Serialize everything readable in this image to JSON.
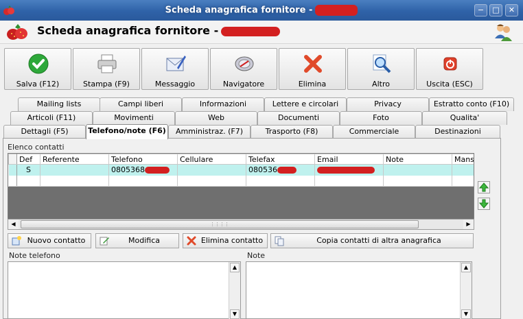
{
  "window": {
    "title": "Scheda anagrafica fornitore -",
    "controls": [
      "−",
      "□",
      "✕"
    ]
  },
  "header": {
    "title": "Scheda anagrafica fornitore -"
  },
  "toolbar": {
    "buttons": [
      {
        "label": "Salva (F12)",
        "icon": "check-icon"
      },
      {
        "label": "Stampa (F9)",
        "icon": "printer-icon"
      },
      {
        "label": "Messaggio",
        "icon": "message-icon"
      },
      {
        "label": "Navigatore",
        "icon": "compass-icon"
      },
      {
        "label": "Elimina",
        "icon": "delete-icon"
      },
      {
        "label": "Altro",
        "icon": "search-icon"
      },
      {
        "label": "Uscita (ESC)",
        "icon": "exit-icon"
      }
    ]
  },
  "tabs": {
    "row1": [
      "Mailing lists",
      "Campi liberi",
      "Informazioni",
      "Lettere e circolari",
      "Privacy",
      "Estratto conto (F10)"
    ],
    "row2": [
      "Articoli (F11)",
      "Movimenti",
      "Web",
      "Documenti",
      "Foto",
      "Qualita'"
    ],
    "row3": [
      "Dettagli (F5)",
      "Telefono/note (F6)",
      "Amministraz. (F7)",
      "Trasporto (F8)",
      "Commerciale",
      "Destinazioni"
    ],
    "active": "Telefono/note (F6)"
  },
  "contacts": {
    "label": "Elenco contatti",
    "columns": [
      "Def",
      "Referente",
      "Telefono",
      "Cellulare",
      "Telefax",
      "Email",
      "Note",
      "Mansio"
    ],
    "rows": [
      {
        "def": "S",
        "referente": "",
        "telefono": "0805368",
        "cellulare": "",
        "telefax": "080536",
        "email": "",
        "note": "",
        "mansione": ""
      }
    ]
  },
  "actions": {
    "new": "Nuovo contatto",
    "edit": "Modifica",
    "delete": "Elimina contatto",
    "copy": "Copia contatti di altra anagrafica"
  },
  "notes": {
    "phone_label": "Note telefono",
    "note_label": "Note"
  },
  "colors": {
    "titlebar": "#2f62a8",
    "selected_row": "#bff1ee",
    "redaction": "#d32020"
  }
}
